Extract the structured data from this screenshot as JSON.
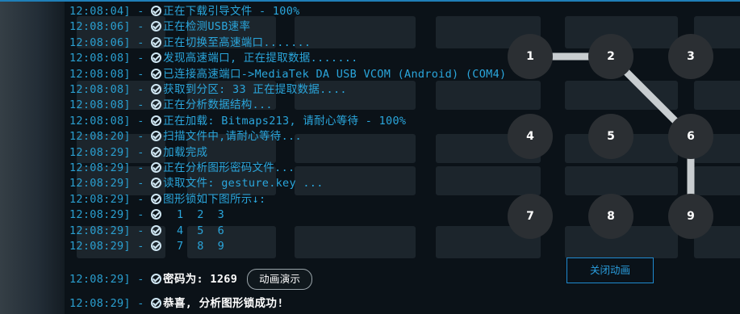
{
  "log": [
    {
      "time": "12:08:04]",
      "msg": "正在下载引导文件 - 100%"
    },
    {
      "time": "12:08:06]",
      "msg": "正在检测USB速率"
    },
    {
      "time": "12:08:06]",
      "msg": "正在切换至高速端口......."
    },
    {
      "time": "12:08:08]",
      "msg": "发现高速端口, 正在提取数据......."
    },
    {
      "time": "12:08:08]",
      "msg": "已连接高速端口->MediaTek DA USB VCOM (Android) (COM4)"
    },
    {
      "time": "12:08:08]",
      "msg": "获取到分区: 33 正在提取数据...."
    },
    {
      "time": "12:08:08]",
      "msg": "正在分析数据结构..."
    },
    {
      "time": "12:08:08]",
      "msg": "正在加载: Bitmaps213, 请耐心等待 - 100%"
    },
    {
      "time": "12:08:20]",
      "msg": "扫描文件中,请耐心等待..."
    },
    {
      "time": "12:08:29]",
      "msg": "加载完成"
    },
    {
      "time": "12:08:29]",
      "msg": "正在分析图形密码文件..."
    },
    {
      "time": "12:08:29]",
      "msg": "读取文件: gesture.key ..."
    },
    {
      "time": "12:08:29]",
      "msg": "图形锁如下图所示↓:"
    },
    {
      "time": "12:08:29]",
      "msg": "  1  2  3"
    },
    {
      "time": "12:08:29]",
      "msg": "  4  5  6"
    },
    {
      "time": "12:08:29]",
      "msg": "  7  8  9"
    }
  ],
  "password_line": {
    "time": "12:08:29]",
    "label": "密码为: 1269",
    "button": "动画演示"
  },
  "success_line": {
    "time": "12:08:29]",
    "msg": "恭喜, 分析图形锁成功!"
  },
  "separator": " - ",
  "pattern": {
    "nodes": [
      "1",
      "2",
      "3",
      "4",
      "5",
      "6",
      "7",
      "8",
      "9"
    ],
    "sequence": [
      "1",
      "2",
      "6",
      "9"
    ],
    "line_color": "#c8cdd0",
    "node_color": "#2b2f33"
  },
  "close_button": "关闭动画",
  "colors": {
    "log_text": "#2aa6dc",
    "accent": "#1f8ad0",
    "background": "#0b1218"
  }
}
